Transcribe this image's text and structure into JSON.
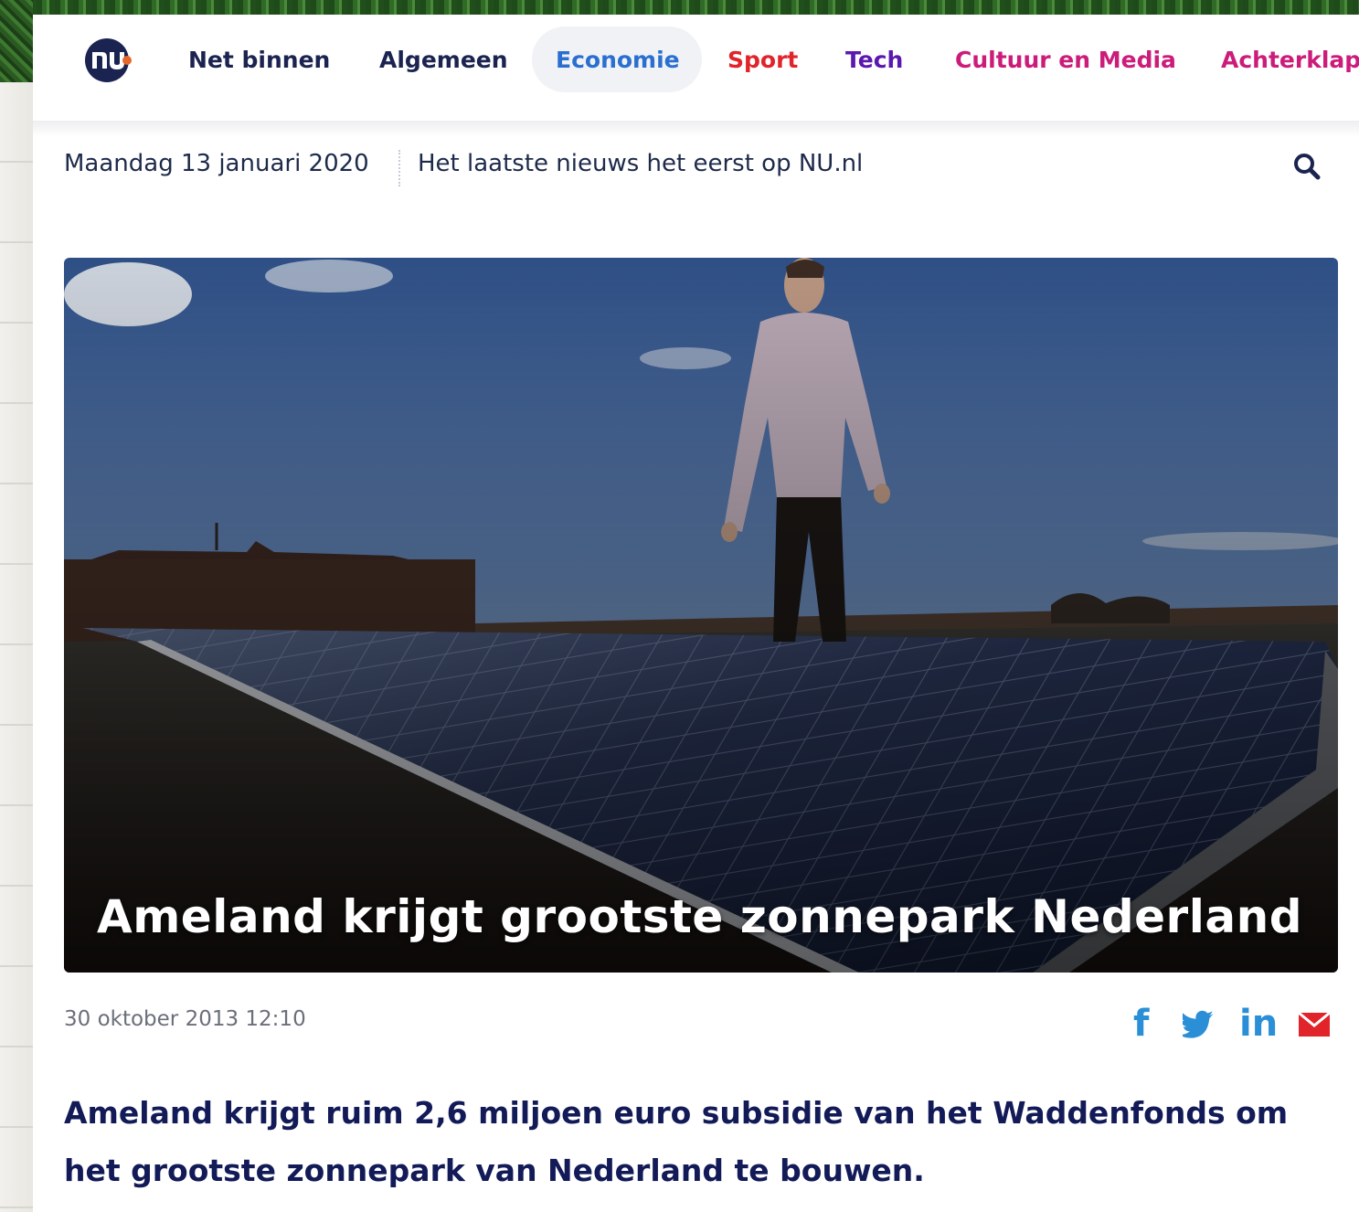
{
  "nav": {
    "items": [
      {
        "label": "Net binnen",
        "color": "#1b2350"
      },
      {
        "label": "Algemeen",
        "color": "#1b2350"
      },
      {
        "label": "Economie",
        "color": "#2a6fd0",
        "active": true
      },
      {
        "label": "Sport",
        "color": "#e0242a"
      },
      {
        "label": "Tech",
        "color": "#5b17b0"
      },
      {
        "label": "Cultuur en Media",
        "color": "#cc1c7a"
      },
      {
        "label": "Achterklap",
        "color": "#cc1c7a"
      }
    ]
  },
  "subbar": {
    "date": "Maandag 13 januari 2020",
    "tagline": "Het laatste nieuws het eerst op NU.nl"
  },
  "article": {
    "title": "Ameland krijgt grootste zonnepark Nederland",
    "timestamp": "30 oktober 2013 12:10",
    "lead": "Ameland krijgt ruim 2,6 miljoen euro subsidie van het Waddenfonds om het grootste zonnepark van Nederland te bouwen."
  },
  "share": {
    "facebook": "f",
    "linkedin": "in"
  },
  "icons": {
    "logo": "nu-logo",
    "search": "search-icon",
    "facebook": "facebook-icon",
    "twitter": "twitter-icon",
    "linkedin": "linkedin-icon",
    "email": "email-icon"
  },
  "colors": {
    "brand": "#1b2350",
    "accent_active": "#2a6fd0",
    "lead_text": "#121a57",
    "share_blue": "#2a8fd6",
    "share_red": "#e0242a"
  }
}
